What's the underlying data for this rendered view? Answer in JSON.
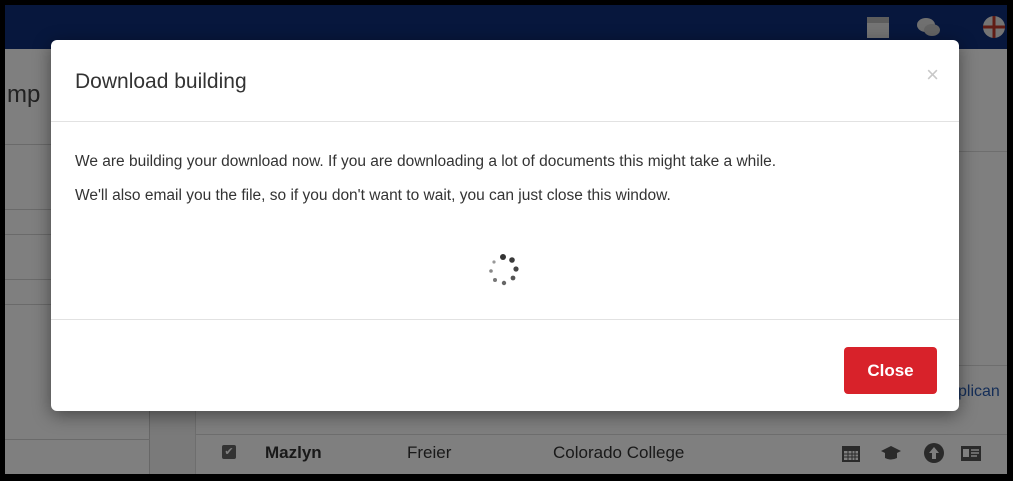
{
  "background": {
    "page_title_fragment": "mp",
    "link_fragment": "plican",
    "row": {
      "checkbox": "✔",
      "first_name": "Mazlyn",
      "last_name": "Freier",
      "school": "Colorado College"
    },
    "icons": [
      "calendar-icon",
      "chat-icon",
      "globe-icon",
      "graduation-cap-icon",
      "upload-icon",
      "id-card-icon"
    ]
  },
  "modal": {
    "title": "Download building",
    "close_x": "×",
    "paragraph_1": "We are building your download now. If you are downloading a lot of documents this might take a while.",
    "paragraph_2": "We'll also email you the file, so if you don't want to wait, you can just close this window.",
    "close_button": "Close"
  },
  "colors": {
    "topbar": "#0f2f7a",
    "close_button": "#d8222a"
  }
}
